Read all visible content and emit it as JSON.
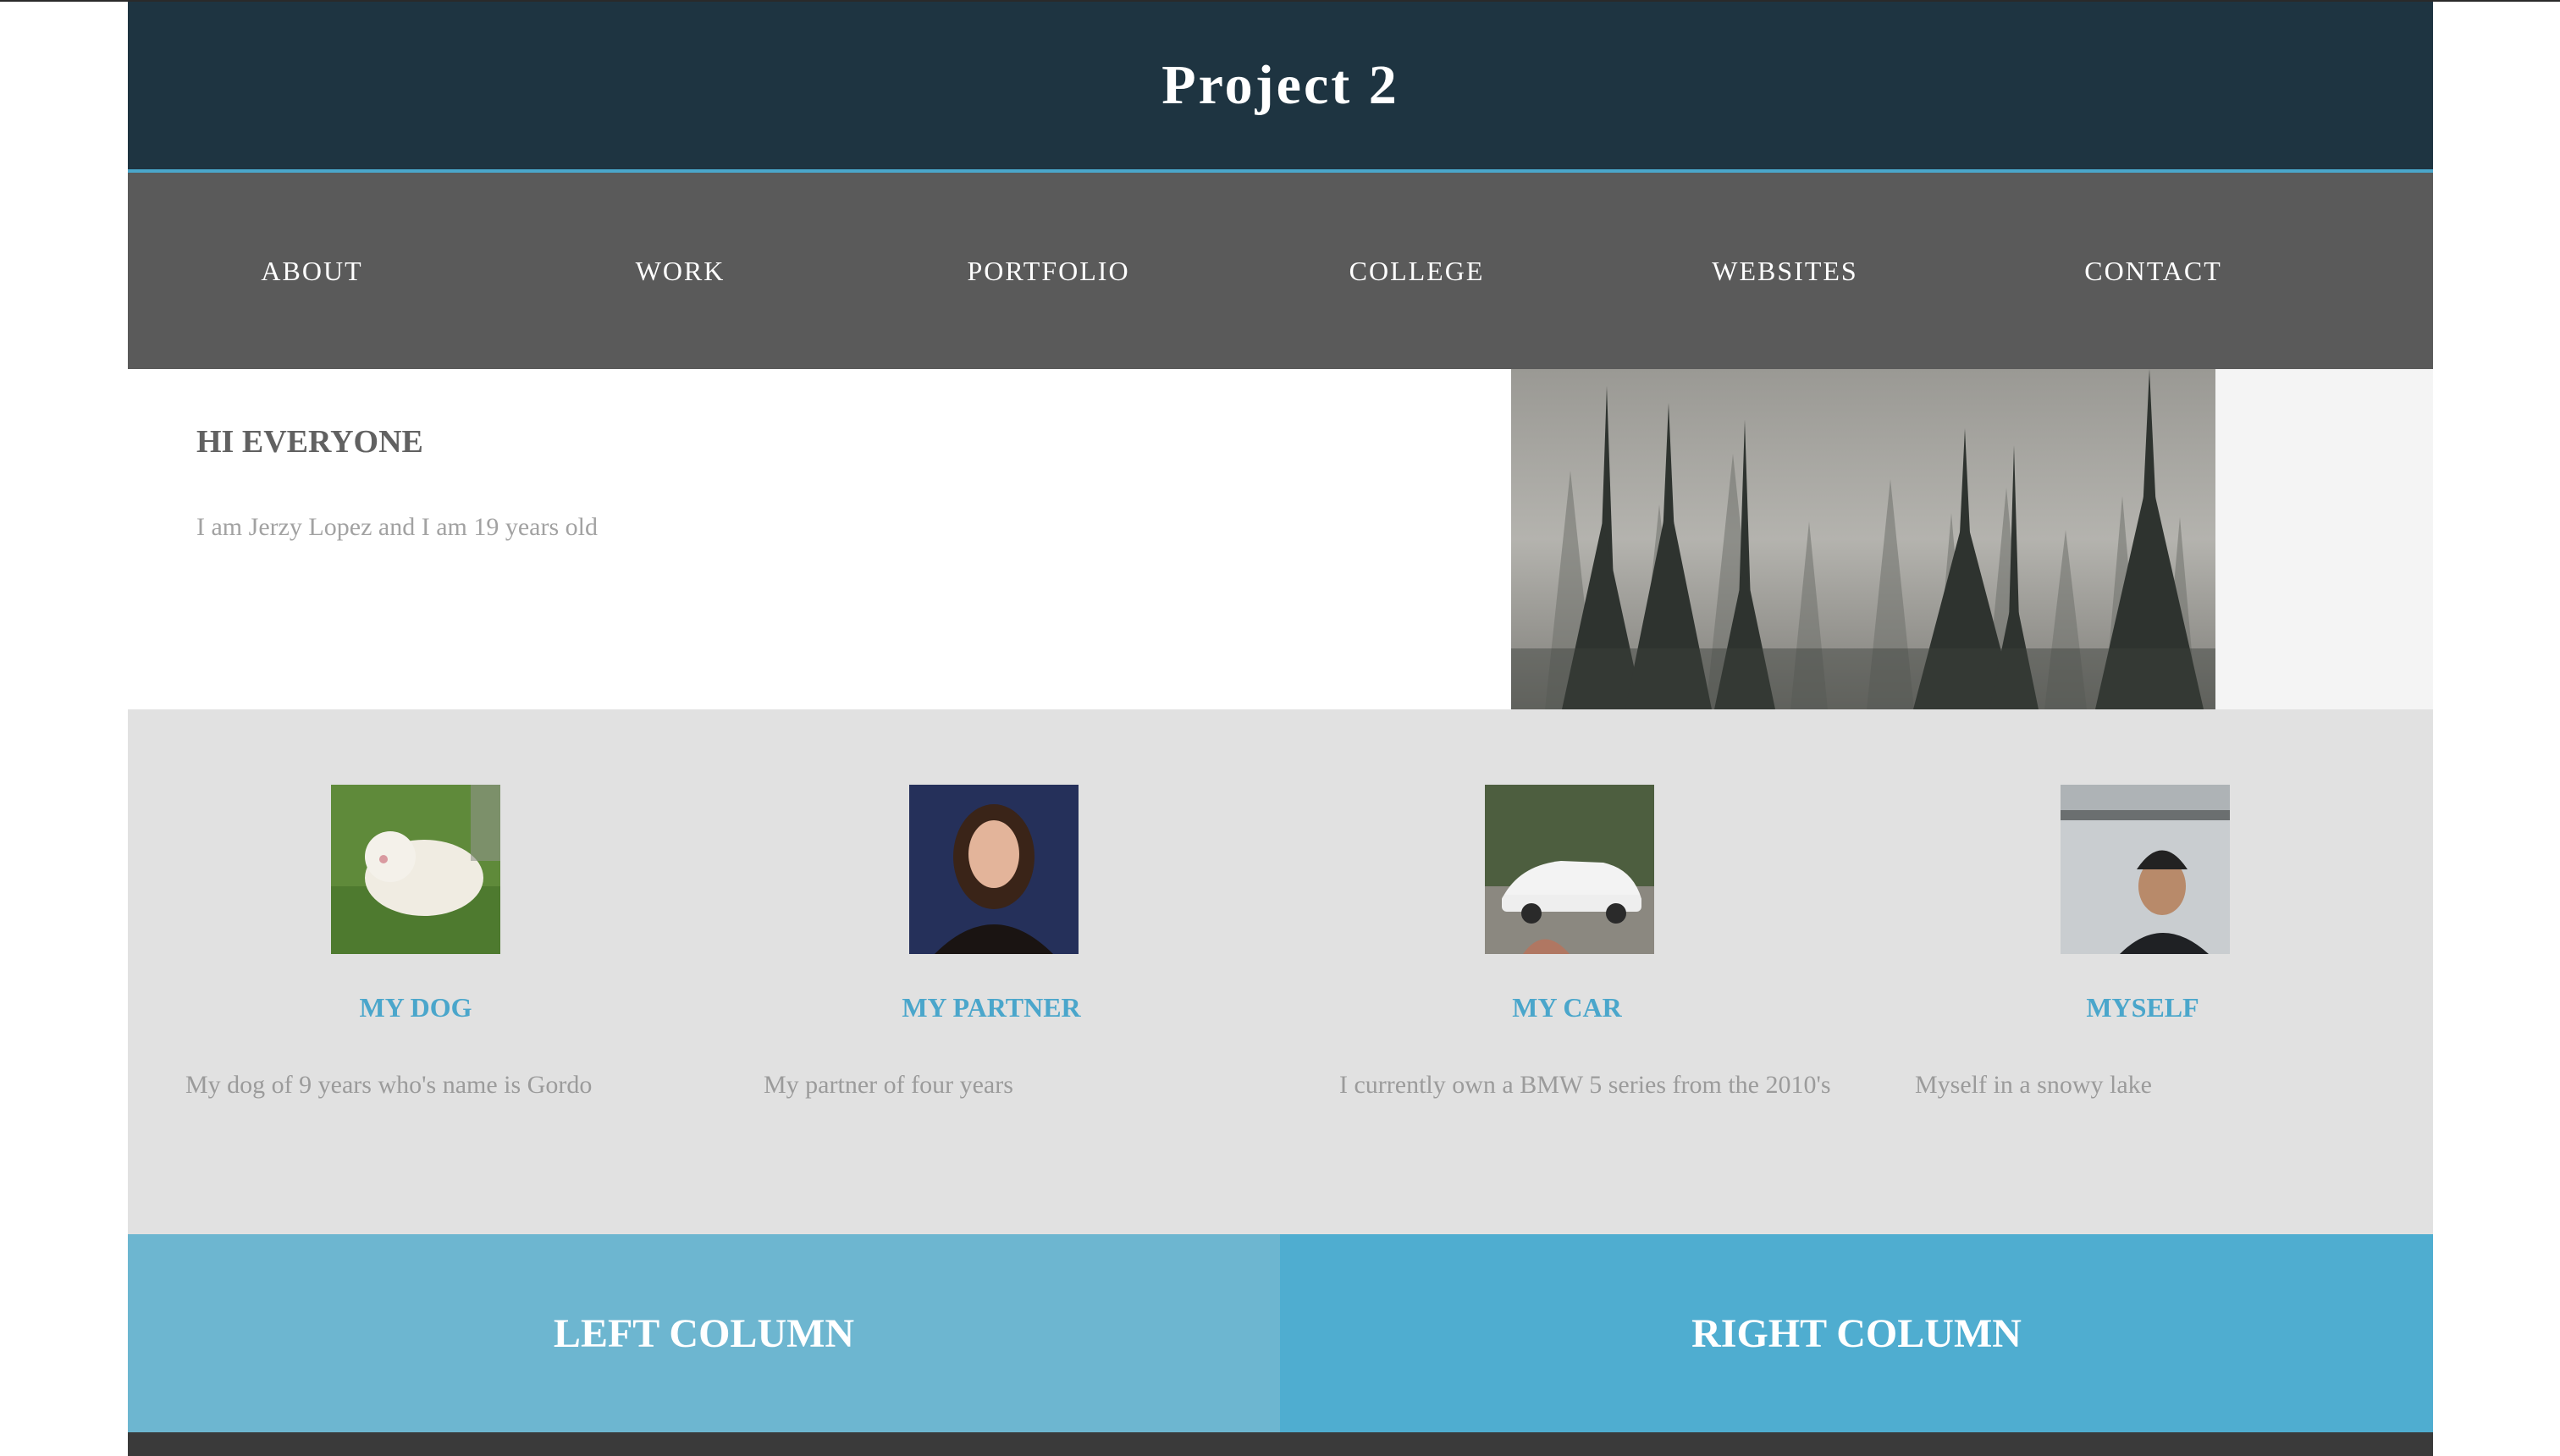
{
  "header": {
    "title": "Project 2"
  },
  "nav": {
    "items": [
      {
        "label": "ABOUT"
      },
      {
        "label": "WORK"
      },
      {
        "label": "PORTFOLIO"
      },
      {
        "label": "COLLEGE"
      },
      {
        "label": "WEBSITES"
      },
      {
        "label": "CONTACT"
      }
    ]
  },
  "intro": {
    "heading": "HI EVERYONE",
    "text": "I am Jerzy Lopez and I am 19 years old",
    "image": "misty-forest-photo"
  },
  "cards": [
    {
      "title": "MY DOG",
      "text": "My dog of 9 years who's name is Gordo",
      "image": "white-dog-on-grass-photo"
    },
    {
      "title": "MY PARTNER",
      "text": "My partner of four years",
      "image": "portrait-photo"
    },
    {
      "title": "MY CAR",
      "text": "I currently own a BMW 5 series from the 2010's",
      "image": "white-car-photo"
    },
    {
      "title": "MYSELF",
      "text": "Myself  in a snowy lake",
      "image": "snowy-lake-selfie-photo"
    }
  ],
  "columns": {
    "left": "LEFT COLUMN",
    "right": "RIGHT COLUMN"
  },
  "colors": {
    "header_bg": "#1e3441",
    "accent": "#4aa6cb",
    "nav_bg": "#5a5a5a",
    "cards_bg": "#e1e1e1",
    "left_column": "#6db6d0",
    "right_column": "#4fadd0"
  }
}
